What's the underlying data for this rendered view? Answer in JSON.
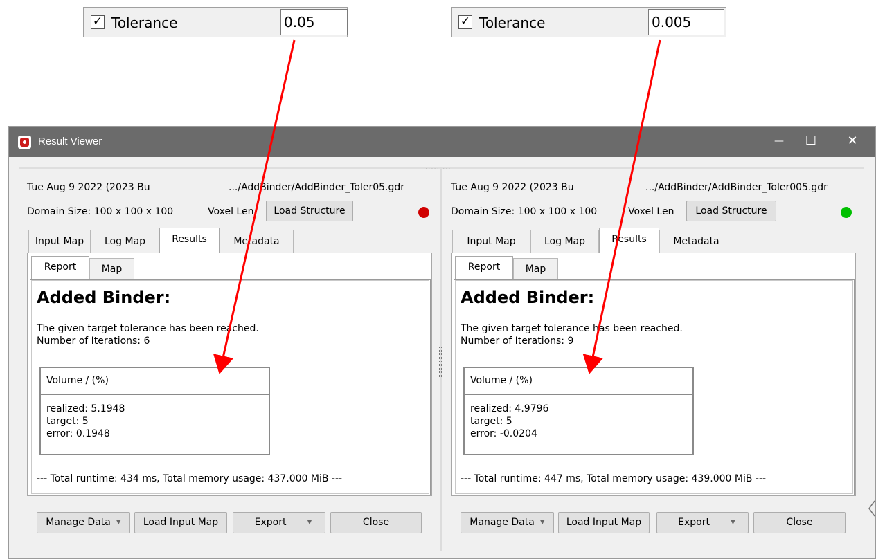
{
  "tolerance_left": {
    "checked": "✓",
    "label": "Tolerance",
    "value": "0.05"
  },
  "tolerance_right": {
    "checked": "✓",
    "label": "Tolerance",
    "value": "0.005"
  },
  "window": {
    "title": "Result Viewer",
    "minimize": "—",
    "maximize": "☐",
    "close": "✕",
    "splitter_dots": "........."
  },
  "left": {
    "date": "Tue Aug 9 2022 (2023 Bu",
    "path": ".../AddBinder/AddBinder_Toler05.gdr",
    "domain": "Domain Size: 100 x 100 x 100",
    "voxel": "Voxel Len",
    "load_structure": "Load Structure",
    "status_color": "#d00000",
    "tabs": [
      "Input Map",
      "Log Map",
      "Results",
      "Metadata"
    ],
    "subtabs": [
      "Report",
      "Map"
    ],
    "heading": "Added Binder:",
    "msg1": "The given target tolerance has been reached.",
    "msg2": "Number of Iterations: 6",
    "vol_header": "Volume / (%)",
    "realized": "realized: 5.1948",
    "target": "target: 5",
    "error": "error: 0.1948",
    "runtime": "--- Total runtime: 434 ms, Total memory usage: 437.000 MiB ---",
    "buttons": {
      "manage": "Manage Data",
      "load_input": "Load Input Map",
      "export": "Export",
      "close": "Close"
    }
  },
  "right": {
    "date": "Tue Aug 9 2022 (2023 Bu",
    "path": ".../AddBinder/AddBinder_Toler005.gdr",
    "domain": "Domain Size: 100 x 100 x 100",
    "voxel": "Voxel Len",
    "load_structure": "Load Structure",
    "status_color": "#00c000",
    "tabs": [
      "Input Map",
      "Log Map",
      "Results",
      "Metadata"
    ],
    "subtabs": [
      "Report",
      "Map"
    ],
    "heading": "Added Binder:",
    "msg1": "The given target tolerance has been reached.",
    "msg2": "Number of Iterations: 9",
    "vol_header": "Volume / (%)",
    "realized": "realized: 4.9796",
    "target": "target: 5",
    "error": "error: -0.0204",
    "runtime": "--- Total runtime: 447 ms, Total memory usage: 439.000 MiB ---",
    "buttons": {
      "manage": "Manage Data",
      "load_input": "Load Input Map",
      "export": "Export",
      "close": "Close"
    }
  },
  "colors": {
    "arrow": "#ff0000",
    "titlebar": "#6b6b6b"
  }
}
